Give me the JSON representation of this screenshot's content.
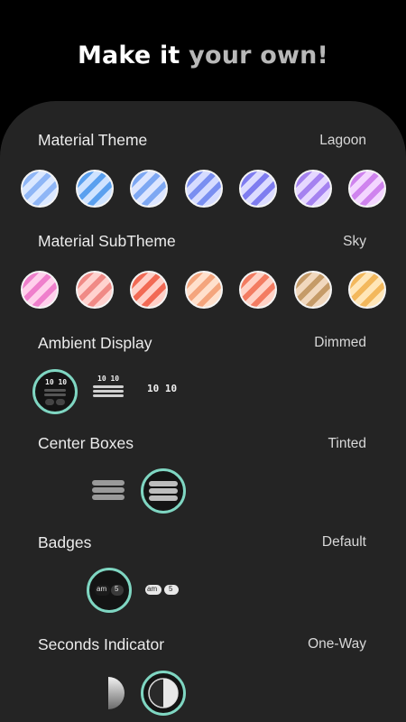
{
  "headline": {
    "part1": "Make it ",
    "part2": "your own!"
  },
  "sections": {
    "material_theme": {
      "label": "Material Theme",
      "value": "Lagoon",
      "swatches": [
        [
          "#dbe8ff",
          "#8fb6f6"
        ],
        [
          "#cfe3ff",
          "#5aa0ef"
        ],
        [
          "#dde6ff",
          "#7ea8f3"
        ],
        [
          "#d6dcff",
          "#7a8ff1"
        ],
        [
          "#dcdcff",
          "#7f7df0"
        ],
        [
          "#e6d8ff",
          "#a582f0"
        ],
        [
          "#f3d6ff",
          "#cf83ee"
        ]
      ]
    },
    "material_subtheme": {
      "label": "Material SubTheme",
      "value": "Sky",
      "swatches": [
        [
          "#ffd0ec",
          "#ef7fcc"
        ],
        [
          "#ffd2cf",
          "#f08a86"
        ],
        [
          "#ffd0c8",
          "#f26a55"
        ],
        [
          "#ffe0cc",
          "#f4a57d"
        ],
        [
          "#ffd2c6",
          "#f37c62"
        ],
        [
          "#f1d8be",
          "#c59b68"
        ],
        [
          "#ffe6b8",
          "#f3b85c"
        ]
      ]
    },
    "ambient_display": {
      "label": "Ambient Display",
      "value": "Dimmed",
      "option_time": "10 10"
    },
    "center_boxes": {
      "label": "Center Boxes",
      "value": "Tinted"
    },
    "badges": {
      "label": "Badges",
      "value": "Default",
      "badge_am": "am",
      "badge_num": "5"
    },
    "seconds_indicator": {
      "label": "Seconds Indicator",
      "value": "One-Way"
    }
  },
  "colors": {
    "accent_ring": "#7fd6c2",
    "card_bg": "#242424",
    "page_bg": "#000000"
  }
}
